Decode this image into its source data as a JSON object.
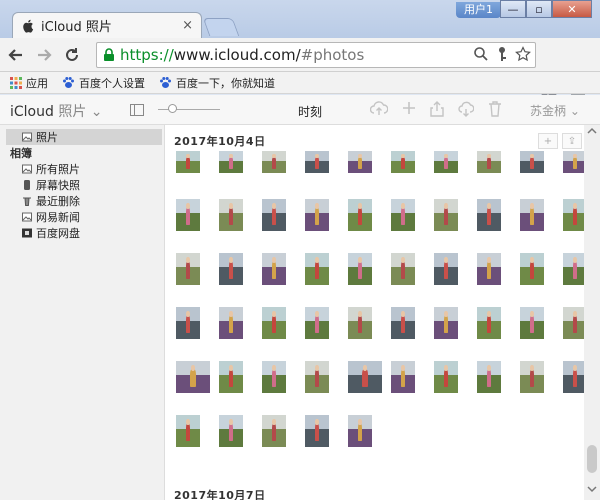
{
  "window": {
    "tab_title": "iCloud 照片",
    "tab_close": "×",
    "user_badge": "用户1",
    "min_glyph": "—",
    "max_glyph": "▫",
    "close_glyph": "✕"
  },
  "toolbar": {
    "url_scheme": "https://",
    "url_host": "www.icloud.com/",
    "url_hash": "#photos"
  },
  "bookmarks": [
    {
      "label": "应用",
      "icon": "apps-grid-icon"
    },
    {
      "label": "百度个人设置",
      "icon": "baidu-paw-icon"
    },
    {
      "label": "百度一下，你就知道",
      "icon": "baidu-paw-icon"
    }
  ],
  "appbar": {
    "brand": "iCloud",
    "app_name": "照片",
    "chevron": "⌄",
    "view_label": "时刻",
    "user_name": "苏金柄",
    "user_chevron": "⌄"
  },
  "sidebar": {
    "active_item": "照片",
    "albums_header": "相簿",
    "items": [
      {
        "label": "所有照片",
        "icon": "photos-icon"
      },
      {
        "label": "屏幕快照",
        "icon": "phone-icon"
      },
      {
        "label": "最近删除",
        "icon": "trash-icon"
      },
      {
        "label": "网易新闻",
        "icon": "album-icon"
      },
      {
        "label": "百度网盘",
        "icon": "album-dark-icon"
      }
    ]
  },
  "content": {
    "date_1": "2017年10月4日",
    "date_2": "2017年10月7日",
    "mini_plus": "+",
    "mini_share": "⇪"
  },
  "colors": {
    "https_green": "#0a8f2a",
    "sidebar_bg": "#f1f1f1",
    "active_item_bg": "#d4d4d4",
    "chrome_blue": "#c9d7ec"
  }
}
